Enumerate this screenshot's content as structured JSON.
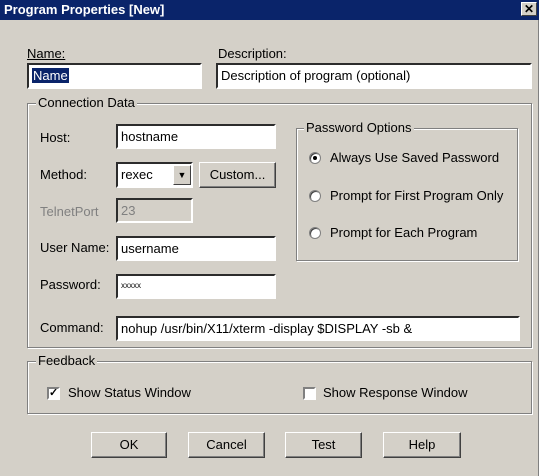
{
  "window": {
    "title": "Program Properties  [New]",
    "close_glyph": "✕"
  },
  "name": {
    "label": "Name:",
    "value": "Name"
  },
  "description": {
    "label": "Description:",
    "value": "Description of program (optional)"
  },
  "connection": {
    "group_label": "Connection Data",
    "host": {
      "label": "Host:",
      "value": "hostname"
    },
    "method": {
      "label": "Method:",
      "value": "rexec",
      "custom_button": "Custom..."
    },
    "telnetport": {
      "label": "TelnetPort",
      "value": "23"
    },
    "username": {
      "label": "User Name:",
      "value": "username"
    },
    "password": {
      "label": "Password:",
      "value": "xxxxx"
    },
    "command": {
      "label": "Command:",
      "value": "nohup /usr/bin/X11/xterm -display $DISPLAY -sb &"
    }
  },
  "password_options": {
    "group_label": "Password Options",
    "options": [
      {
        "label": "Always Use Saved Password",
        "selected": true
      },
      {
        "label": "Prompt for First Program Only",
        "selected": false
      },
      {
        "label": "Prompt for Each Program",
        "selected": false
      }
    ]
  },
  "feedback": {
    "group_label": "Feedback",
    "show_status": {
      "label": "Show Status Window",
      "checked": true
    },
    "show_response": {
      "label": "Show Response Window",
      "checked": false
    }
  },
  "buttons": {
    "ok": "OK",
    "cancel": "Cancel",
    "test": "Test",
    "help": "Help"
  }
}
